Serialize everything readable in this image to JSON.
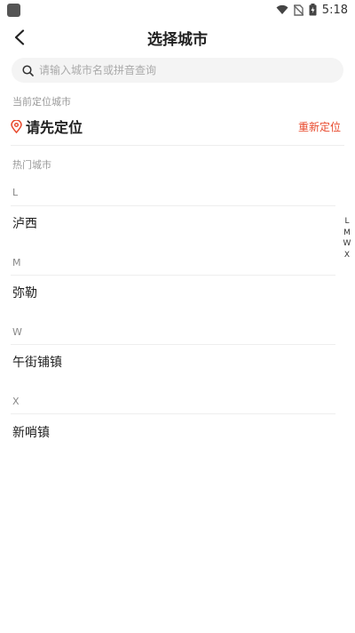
{
  "status_bar": {
    "time": "5:18",
    "icons": [
      "wifi-icon",
      "no-sim-icon",
      "battery-charging-icon"
    ]
  },
  "nav": {
    "title": "选择城市",
    "back_icon": "chevron-left-icon"
  },
  "search": {
    "placeholder": "请输入城市名或拼音查询",
    "icon": "search-icon"
  },
  "current_location": {
    "section_label": "当前定位城市",
    "value": "请先定位",
    "relocate_label": "重新定位",
    "accent_color": "#e8492c"
  },
  "hot_cities": {
    "section_label": "热门城市"
  },
  "city_groups": [
    {
      "letter": "L",
      "cities": [
        "泸西"
      ]
    },
    {
      "letter": "M",
      "cities": [
        "弥勒"
      ]
    },
    {
      "letter": "W",
      "cities": [
        "午街铺镇"
      ]
    },
    {
      "letter": "X",
      "cities": [
        "新哨镇"
      ]
    }
  ],
  "index_letters": [
    "L",
    "M",
    "W",
    "X"
  ]
}
